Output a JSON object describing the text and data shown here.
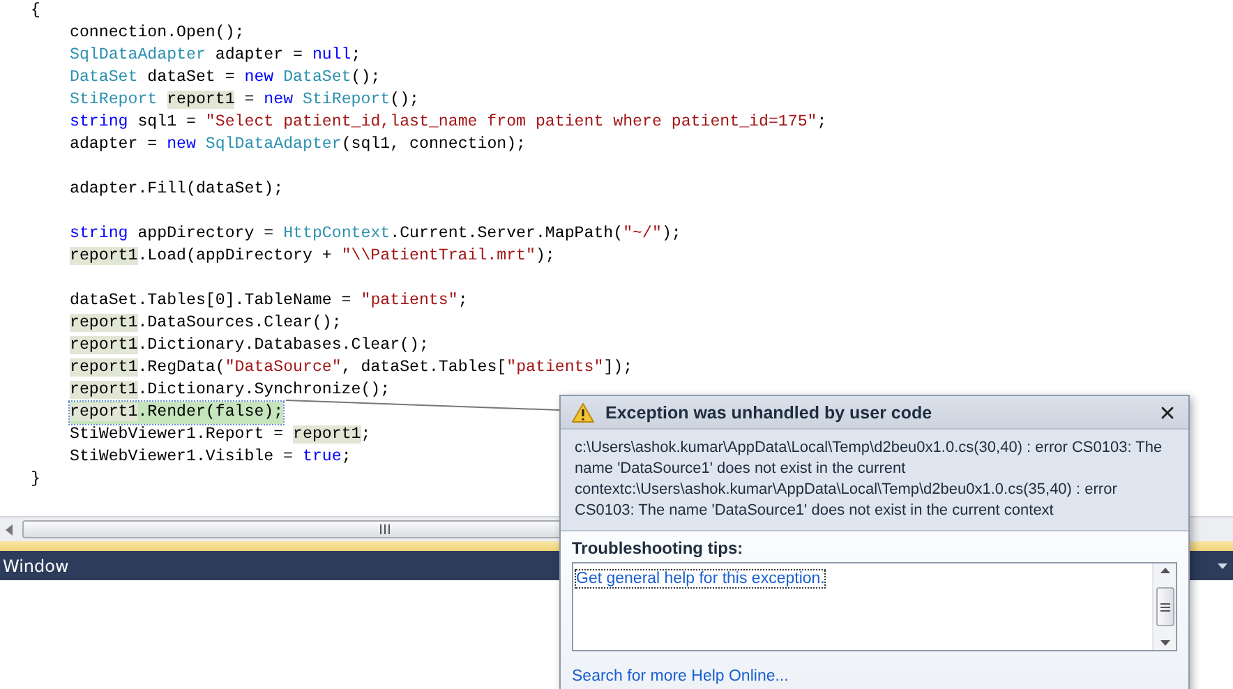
{
  "editor": {
    "code": {
      "open": "{",
      "close": "}",
      "groups": [
        {
          "lines": [
            {
              "current": false,
              "tokens": [
                {
                  "kind": "text",
                  "text": "connection.Open();"
                }
              ]
            },
            {
              "current": false,
              "tokens": [
                {
                  "kind": "type",
                  "text": "SqlDataAdapter"
                },
                {
                  "kind": "text",
                  "text": " adapter = "
                },
                {
                  "kind": "keyword",
                  "text": "null"
                },
                {
                  "kind": "text",
                  "text": ";"
                }
              ]
            },
            {
              "current": false,
              "tokens": [
                {
                  "kind": "type",
                  "text": "DataSet"
                },
                {
                  "kind": "text",
                  "text": " dataSet = "
                },
                {
                  "kind": "keyword",
                  "text": "new"
                },
                {
                  "kind": "type",
                  "text": " DataSet"
                },
                {
                  "kind": "text",
                  "text": "();"
                }
              ]
            },
            {
              "current": false,
              "tokens": [
                {
                  "kind": "type",
                  "text": "StiReport "
                },
                {
                  "kind": "ref",
                  "text": "report1"
                },
                {
                  "kind": "text",
                  "text": " = "
                },
                {
                  "kind": "keyword",
                  "text": "new"
                },
                {
                  "kind": "type",
                  "text": " StiReport"
                },
                {
                  "kind": "text",
                  "text": "();"
                }
              ]
            },
            {
              "current": false,
              "tokens": [
                {
                  "kind": "keyword",
                  "text": "string"
                },
                {
                  "kind": "text",
                  "text": " sql1 = "
                },
                {
                  "kind": "string",
                  "text": "\"Select patient_id,last_name from patient where patient_id=175\""
                },
                {
                  "kind": "text",
                  "text": ";"
                }
              ]
            },
            {
              "current": false,
              "tokens": [
                {
                  "kind": "text",
                  "text": "adapter = "
                },
                {
                  "kind": "keyword",
                  "text": "new"
                },
                {
                  "kind": "type",
                  "text": " SqlDataAdapter"
                },
                {
                  "kind": "text",
                  "text": "(sql1, connection);"
                }
              ]
            }
          ]
        },
        {
          "lines": [
            {
              "current": false,
              "tokens": [
                {
                  "kind": "text",
                  "text": "adapter.Fill(dataSet);"
                }
              ]
            }
          ]
        },
        {
          "lines": [
            {
              "current": false,
              "tokens": [
                {
                  "kind": "keyword",
                  "text": "string"
                },
                {
                  "kind": "text",
                  "text": " appDirectory = "
                },
                {
                  "kind": "type",
                  "text": "HttpContext"
                },
                {
                  "kind": "text",
                  "text": ".Current.Server.MapPath("
                },
                {
                  "kind": "string",
                  "text": "\"~/\""
                },
                {
                  "kind": "text",
                  "text": ");"
                }
              ]
            },
            {
              "current": false,
              "tokens": [
                {
                  "kind": "ref",
                  "text": "report1"
                },
                {
                  "kind": "text",
                  "text": ".Load(appDirectory + "
                },
                {
                  "kind": "string",
                  "text": "\"\\\\PatientTrail.mrt\""
                },
                {
                  "kind": "text",
                  "text": ");"
                }
              ]
            }
          ]
        },
        {
          "lines": [
            {
              "current": false,
              "tokens": [
                {
                  "kind": "text",
                  "text": "dataSet.Tables[0].TableName = "
                },
                {
                  "kind": "string",
                  "text": "\"patients\""
                },
                {
                  "kind": "text",
                  "text": ";"
                }
              ]
            },
            {
              "current": false,
              "tokens": [
                {
                  "kind": "ref",
                  "text": "report1"
                },
                {
                  "kind": "text",
                  "text": ".DataSources.Clear();"
                }
              ]
            },
            {
              "current": false,
              "tokens": [
                {
                  "kind": "ref",
                  "text": "report1"
                },
                {
                  "kind": "text",
                  "text": ".Dictionary.Databases.Clear();"
                }
              ]
            },
            {
              "current": false,
              "tokens": [
                {
                  "kind": "ref",
                  "text": "report1"
                },
                {
                  "kind": "text",
                  "text": ".RegData("
                },
                {
                  "kind": "string",
                  "text": "\"DataSource\""
                },
                {
                  "kind": "text",
                  "text": ", dataSet.Tables["
                },
                {
                  "kind": "string",
                  "text": "\"patients\""
                },
                {
                  "kind": "text",
                  "text": "]);"
                }
              ]
            },
            {
              "current": false,
              "tokens": [
                {
                  "kind": "ref",
                  "text": "report1"
                },
                {
                  "kind": "text",
                  "text": ".Dictionary.Synchronize();"
                }
              ]
            },
            {
              "current": true,
              "tokens": [
                {
                  "kind": "ref",
                  "text": "report1"
                },
                {
                  "kind": "text",
                  "text": ".Render(false);"
                }
              ]
            },
            {
              "current": false,
              "tokens": [
                {
                  "kind": "text",
                  "text": "StiWebViewer1.Report = "
                },
                {
                  "kind": "ref",
                  "text": "report1"
                },
                {
                  "kind": "text",
                  "text": ";"
                }
              ]
            },
            {
              "current": false,
              "tokens": [
                {
                  "kind": "text",
                  "text": "StiWebViewer1.Visible = "
                },
                {
                  "kind": "keyword",
                  "text": "true"
                },
                {
                  "kind": "text",
                  "text": ";"
                }
              ]
            }
          ]
        }
      ]
    },
    "panel": {
      "title": "Window"
    }
  },
  "exception_dialog": {
    "title": "Exception was unhandled by user code",
    "message": "c:\\Users\\ashok.kumar\\AppData\\Local\\Temp\\d2beu0x1.0.cs(30,40) : error CS0103: The name 'DataSource1' does not exist in the current contextc:\\Users\\ashok.kumar\\AppData\\Local\\Temp\\d2beu0x1.0.cs(35,40) : error CS0103: The name 'DataSource1' does not exist in the current context",
    "tips_heading": "Troubleshooting tips:",
    "tips": [
      {
        "label": "Get general help for this exception.",
        "focused": true
      }
    ],
    "help_link": "Search for more Help Online..."
  }
}
